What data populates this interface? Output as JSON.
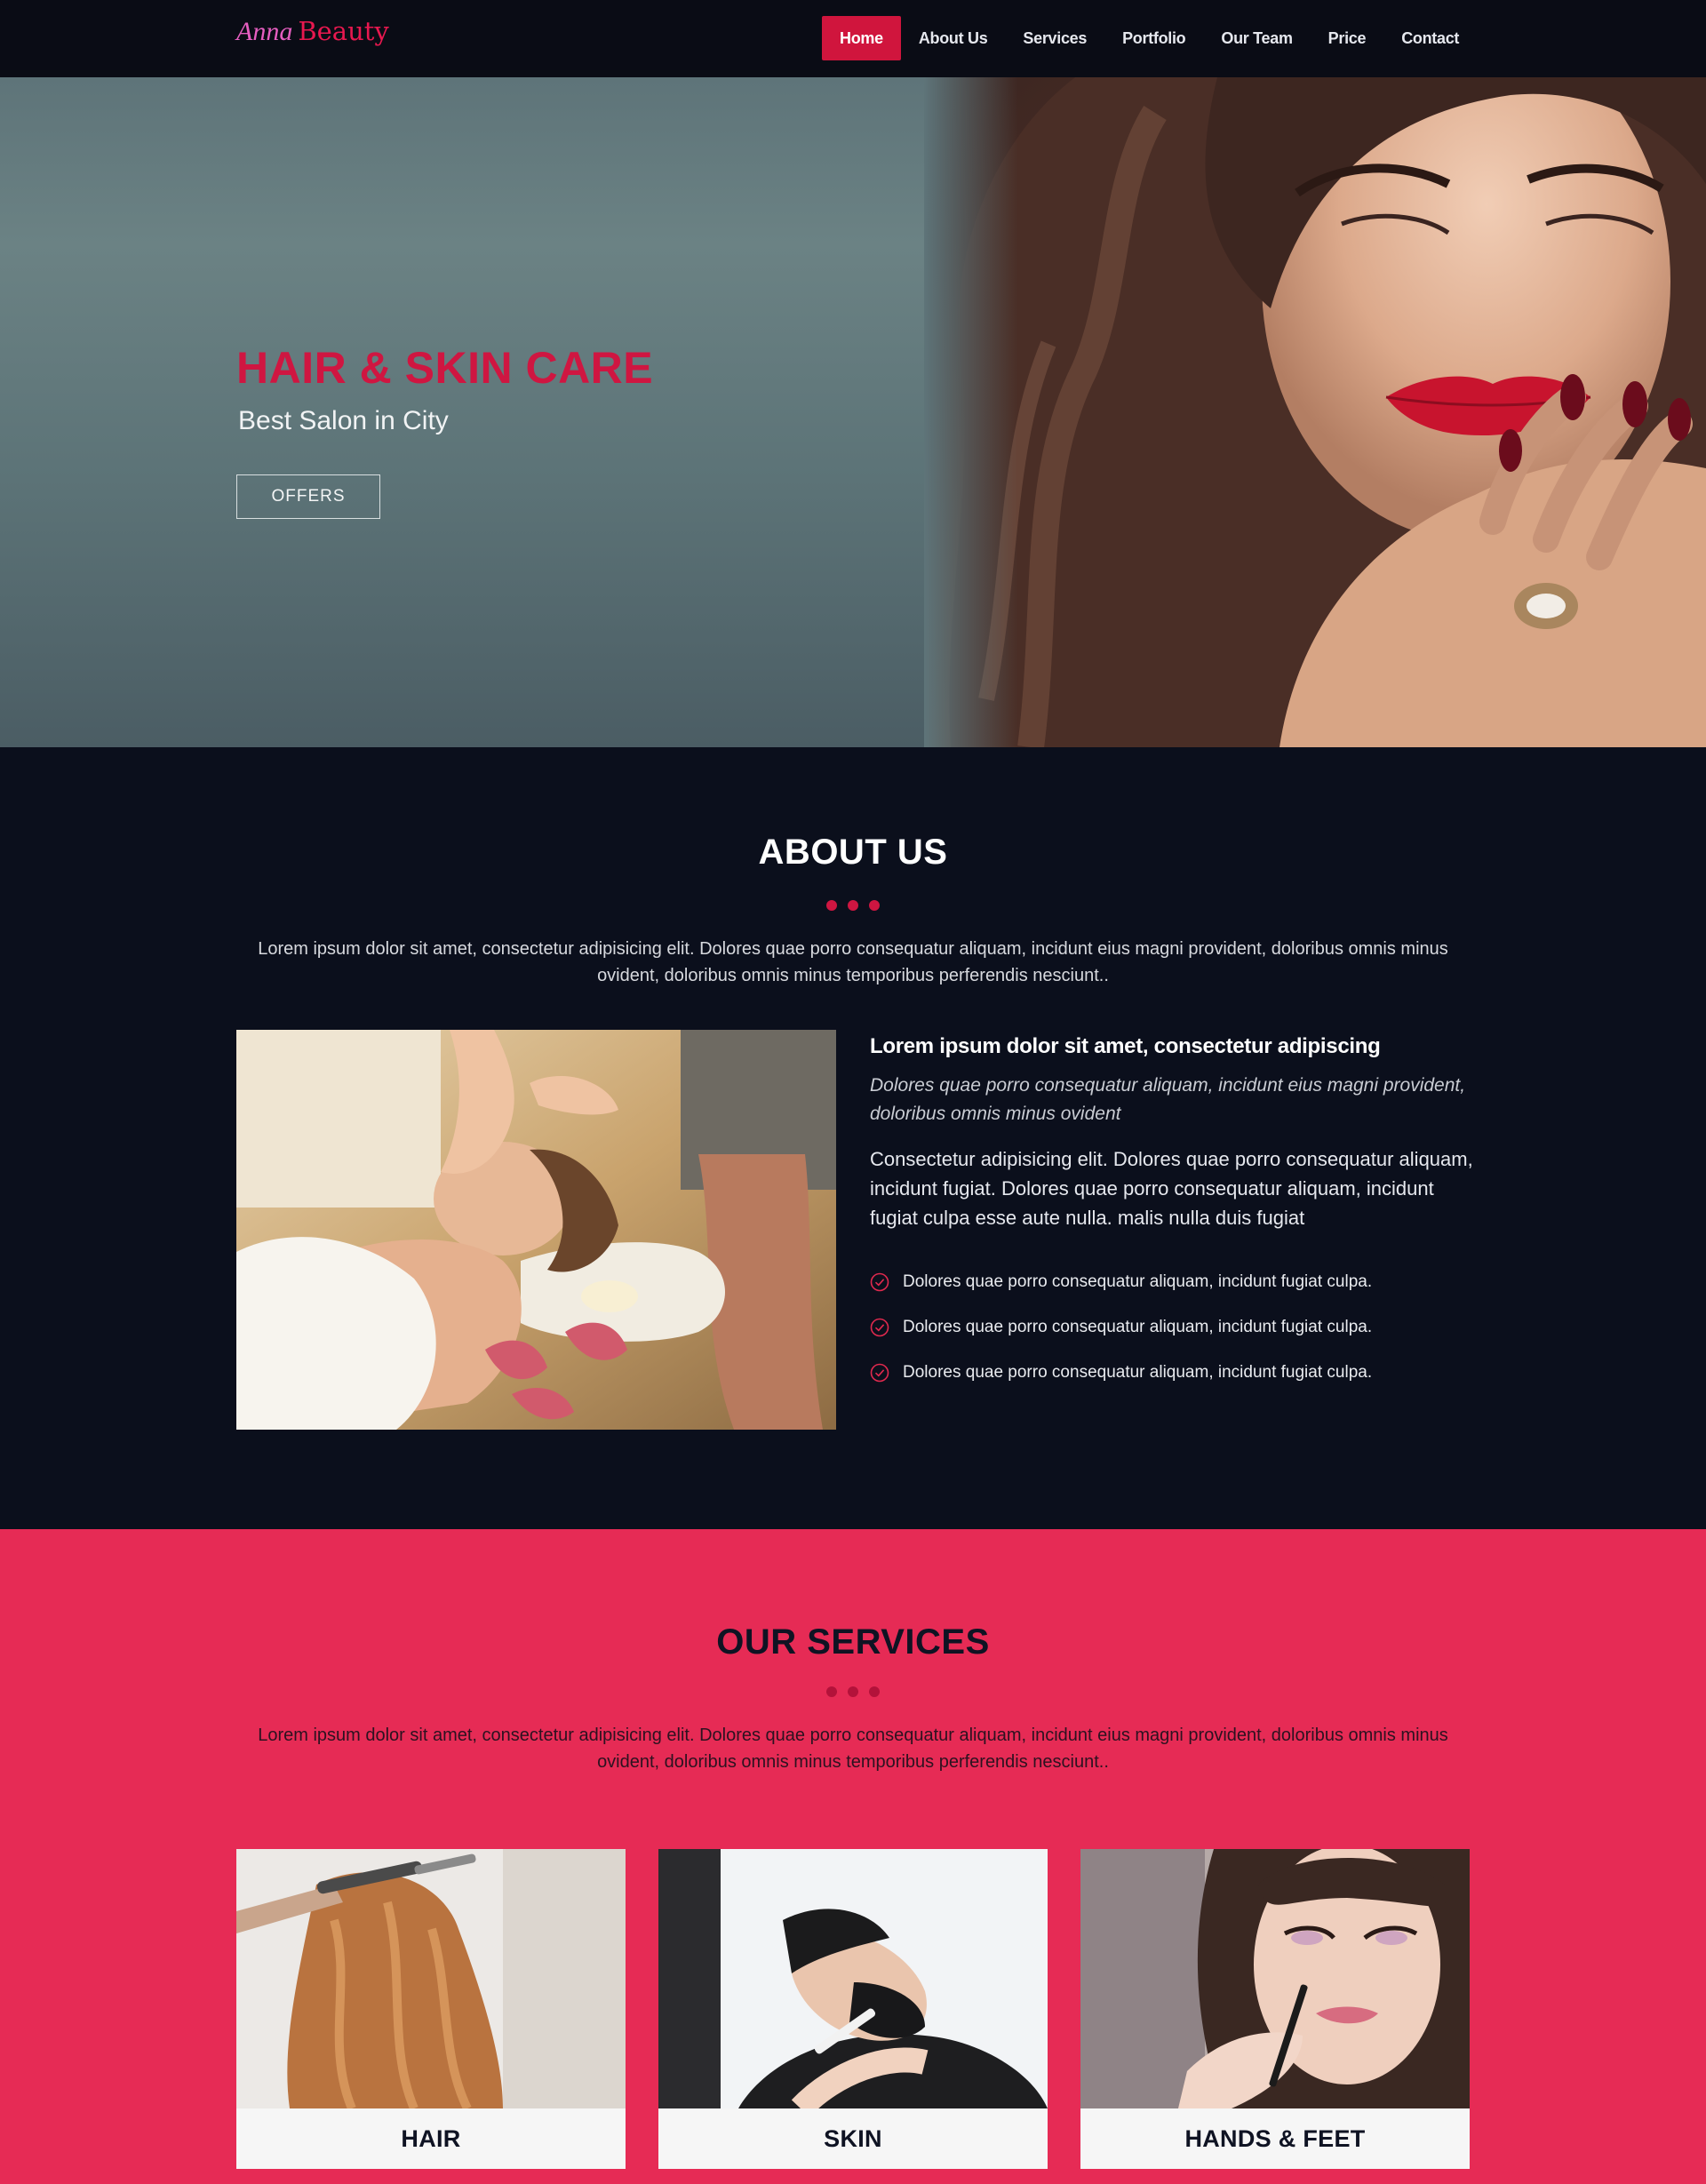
{
  "nav": {
    "logo_script": "Anna",
    "logo_brand": "Beauty",
    "items": [
      {
        "label": "Home",
        "active": true
      },
      {
        "label": "About Us"
      },
      {
        "label": "Services"
      },
      {
        "label": "Portfolio"
      },
      {
        "label": "Our Team"
      },
      {
        "label": "Price"
      },
      {
        "label": "Contact"
      }
    ]
  },
  "hero": {
    "title": "HAIR & SKIN CARE",
    "subtitle": "Best Salon in City",
    "button": "OFFERS"
  },
  "about": {
    "title": "ABOUT US",
    "intro": "Lorem ipsum dolor sit amet, consectetur adipisicing elit. Dolores quae porro consequatur aliquam, incidunt eius magni provident, doloribus omnis minus ovident, doloribus omnis minus temporibus perferendis nesciunt..",
    "heading": "Lorem ipsum dolor sit amet, consectetur adipiscing",
    "italic": "Dolores quae porro consequatur aliquam, incidunt eius magni provident, doloribus omnis minus ovident",
    "paragraph": "Consectetur adipisicing elit. Dolores quae porro consequatur aliquam, incidunt fugiat. Dolores quae porro consequatur aliquam, incidunt fugiat culpa esse aute nulla. malis nulla duis fugiat",
    "checklist": [
      "Dolores quae porro consequatur aliquam, incidunt fugiat culpa.",
      "Dolores quae porro consequatur aliquam, incidunt fugiat culpa.",
      "Dolores quae porro consequatur aliquam, incidunt fugiat culpa."
    ]
  },
  "services": {
    "title": "OUR SERVICES",
    "intro": "Lorem ipsum dolor sit amet, consectetur adipisicing elit. Dolores quae porro consequatur aliquam, incidunt eius magni provident, doloribus omnis minus ovident, doloribus omnis minus temporibus perferendis nesciunt..",
    "cards": [
      {
        "label": "HAIR"
      },
      {
        "label": "SKIN"
      },
      {
        "label": "HANDS & FEET"
      }
    ]
  },
  "colors": {
    "accent": "#cf1641",
    "nav_bg": "#0a0c15",
    "about_bg": "#0b0f1c",
    "services_bg": "#e62b55"
  }
}
